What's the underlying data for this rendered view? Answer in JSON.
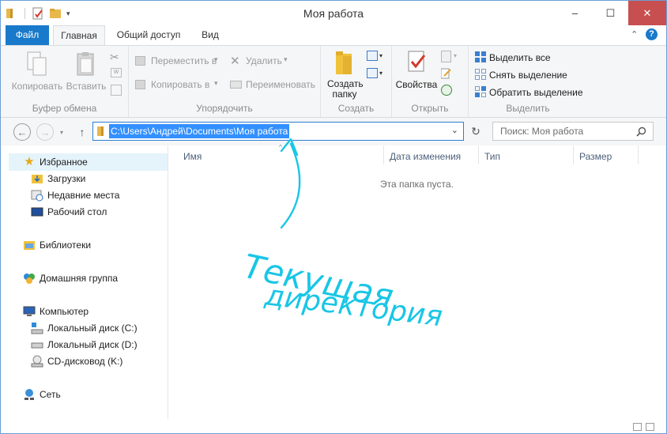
{
  "window": {
    "title": "Моя работа"
  },
  "tabs": {
    "file": "Файл",
    "home": "Главная",
    "share": "Общий доступ",
    "view": "Вид"
  },
  "ribbon": {
    "clipboard": {
      "label": "Буфер обмена",
      "copy": "Копировать",
      "paste": "Вставить"
    },
    "organize": {
      "label": "Упорядочить",
      "move": "Переместить в",
      "copyto": "Копировать в",
      "delete": "Удалить",
      "rename": "Переименовать"
    },
    "new": {
      "label": "Создать",
      "newfolder": "Создать папку"
    },
    "open": {
      "label": "Открыть",
      "properties": "Свойства"
    },
    "select": {
      "label": "Выделить",
      "selectall": "Выделить все",
      "selectnone": "Снять выделение",
      "invert": "Обратить выделение"
    }
  },
  "address": {
    "path": "C:\\Users\\Андрей\\Documents\\Моя работа"
  },
  "search": {
    "placeholder": "Поиск: Моя работа"
  },
  "navpane": {
    "favorites": "Избранное",
    "downloads": "Загрузки",
    "recent": "Недавние места",
    "desktop": "Рабочий стол",
    "libraries": "Библиотеки",
    "homegroup": "Домашняя группа",
    "computer": "Компьютер",
    "disk_c": "Локальный диск (C:)",
    "disk_d": "Локальный диск (D:)",
    "cdrom": "CD-дисковод (K:)",
    "network": "Сеть"
  },
  "columns": {
    "name": "Имя",
    "date": "Дата изменения",
    "type": "Тип",
    "size": "Размер"
  },
  "empty_message": "Эта папка пуста.",
  "annotation": {
    "line1": "Текущая",
    "line2": "директория",
    "color": "#19c6e6"
  },
  "colors": {
    "accent": "#1979ca",
    "close": "#c74f4f",
    "selection": "#3390ff"
  }
}
